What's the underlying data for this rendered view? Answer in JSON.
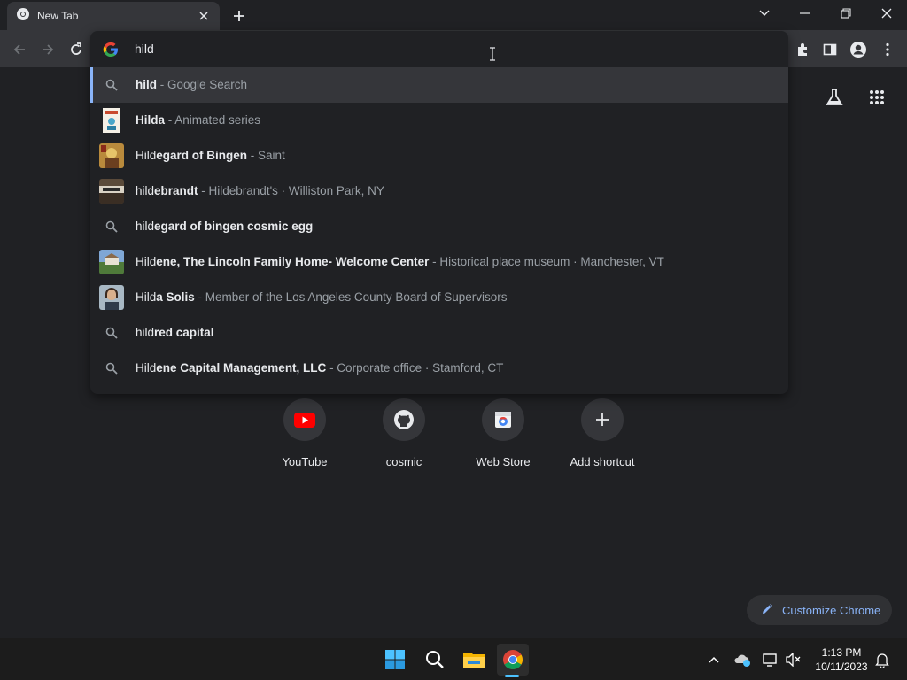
{
  "browser": {
    "tab_title": "New Tab",
    "omnibox_text": "hild"
  },
  "suggestions": [
    {
      "prefix": "hild",
      "bold": "",
      "desc": " - Google Search",
      "icon": "search-icon"
    },
    {
      "prefix": "",
      "bold": "Hilda",
      "desc": " - Animated series",
      "icon": "hilda-thumbnail"
    },
    {
      "prefix": "",
      "bold": "Hildegard of Bingen",
      "desc": " - Saint",
      "icon": "hildegard-thumbnail"
    },
    {
      "prefix": "",
      "bold": "hildebrandt",
      "desc": " - Hildebrandt's · Williston Park, NY",
      "icon": "hildebrandt-thumbnail"
    },
    {
      "prefix": "hild",
      "bold": "egard of bingen cosmic egg",
      "desc": "",
      "icon": "search-icon"
    },
    {
      "prefix": "",
      "bold": "Hildene, The Lincoln Family Home- Welcome Center",
      "desc": " - Historical place museum · Manchester, VT",
      "icon": "hildene-thumbnail"
    },
    {
      "prefix": "",
      "bold": "Hilda Solis",
      "desc": " - Member of the Los Angeles County Board of Supervisors",
      "icon": "hilda-solis-thumbnail"
    },
    {
      "prefix": "hild",
      "bold": "red capital",
      "desc": "",
      "icon": "search-icon"
    },
    {
      "prefix": "",
      "bold": "Hildene Capital Management, LLC",
      "desc": " - Corporate office · Stamford, CT",
      "icon": "search-icon"
    }
  ],
  "shortcuts": [
    {
      "label": "YouTube",
      "icon": "youtube-icon"
    },
    {
      "label": "cosmic",
      "icon": "github-icon"
    },
    {
      "label": "Web Store",
      "icon": "webstore-icon"
    },
    {
      "label": "Add shortcut",
      "icon": "plus-icon"
    }
  ],
  "customize_label": "Customize Chrome",
  "taskbar": {
    "time": "1:13 PM",
    "date": "10/11/2023"
  },
  "colors": {
    "accent": "#8ab4f8",
    "frame": "#35363a",
    "background": "#202124"
  }
}
